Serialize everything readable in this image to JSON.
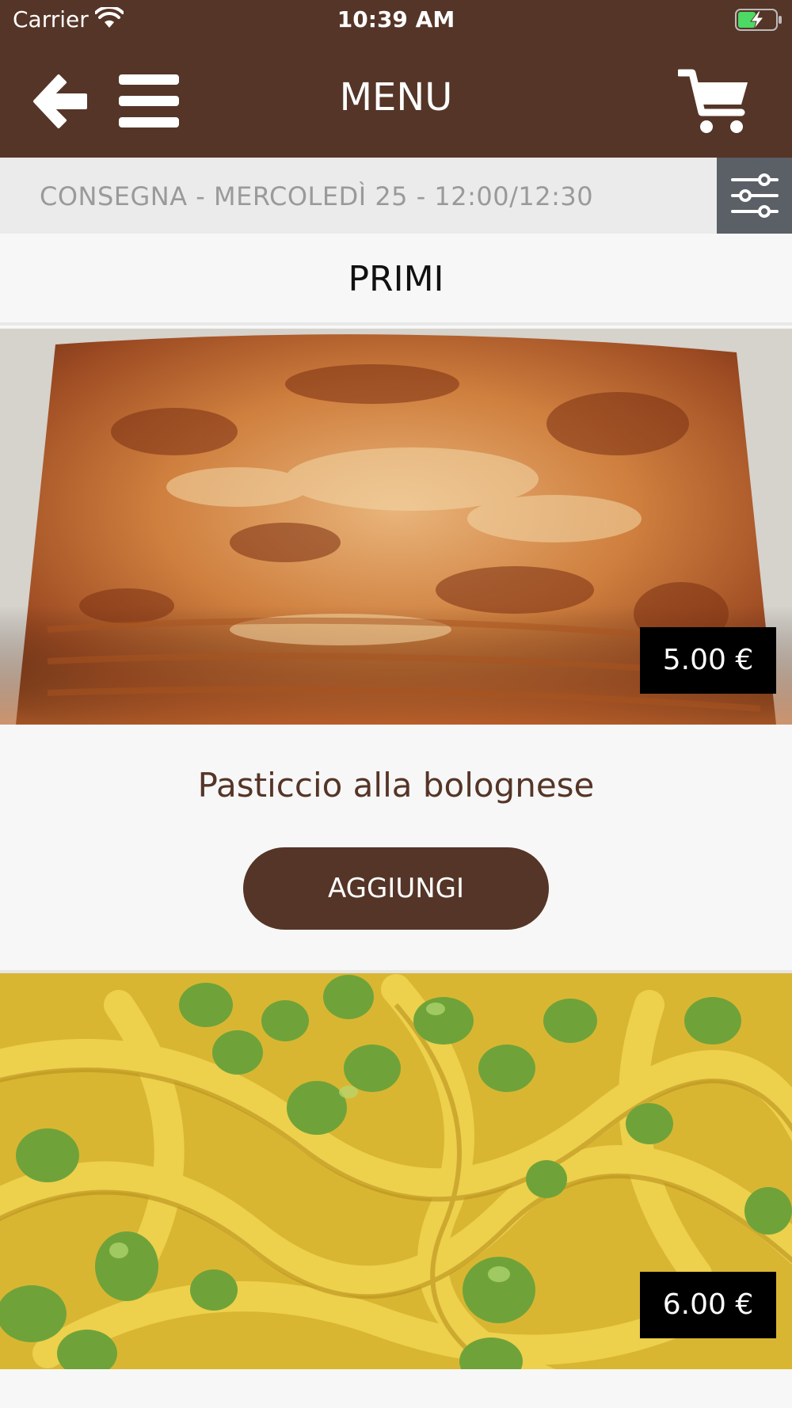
{
  "status_bar": {
    "carrier": "Carrier",
    "time": "10:39 AM",
    "wifi_icon": "wifi-icon",
    "battery_icon": "battery-charging-icon"
  },
  "nav": {
    "title": "MENU",
    "back_icon": "arrow-left-icon",
    "menu_icon": "hamburger-icon",
    "cart_icon": "cart-icon"
  },
  "delivery": {
    "text": "CONSEGNA - MERCOLEDÌ 25 - 12:00/12:30",
    "filter_icon": "sliders-icon"
  },
  "category": {
    "title": "PRIMI"
  },
  "items": [
    {
      "name": "Pasticcio alla bolognese",
      "price": "5.00 €",
      "add_label": "AGGIUNGI"
    },
    {
      "name": "",
      "price": "6.00 €",
      "add_label": ""
    }
  ],
  "colors": {
    "brand_brown": "#553527",
    "background": "#f7f7f7",
    "delivery_bar": "#ebebeb",
    "filter_button": "#5b5f66",
    "price_tag": "#000000"
  }
}
